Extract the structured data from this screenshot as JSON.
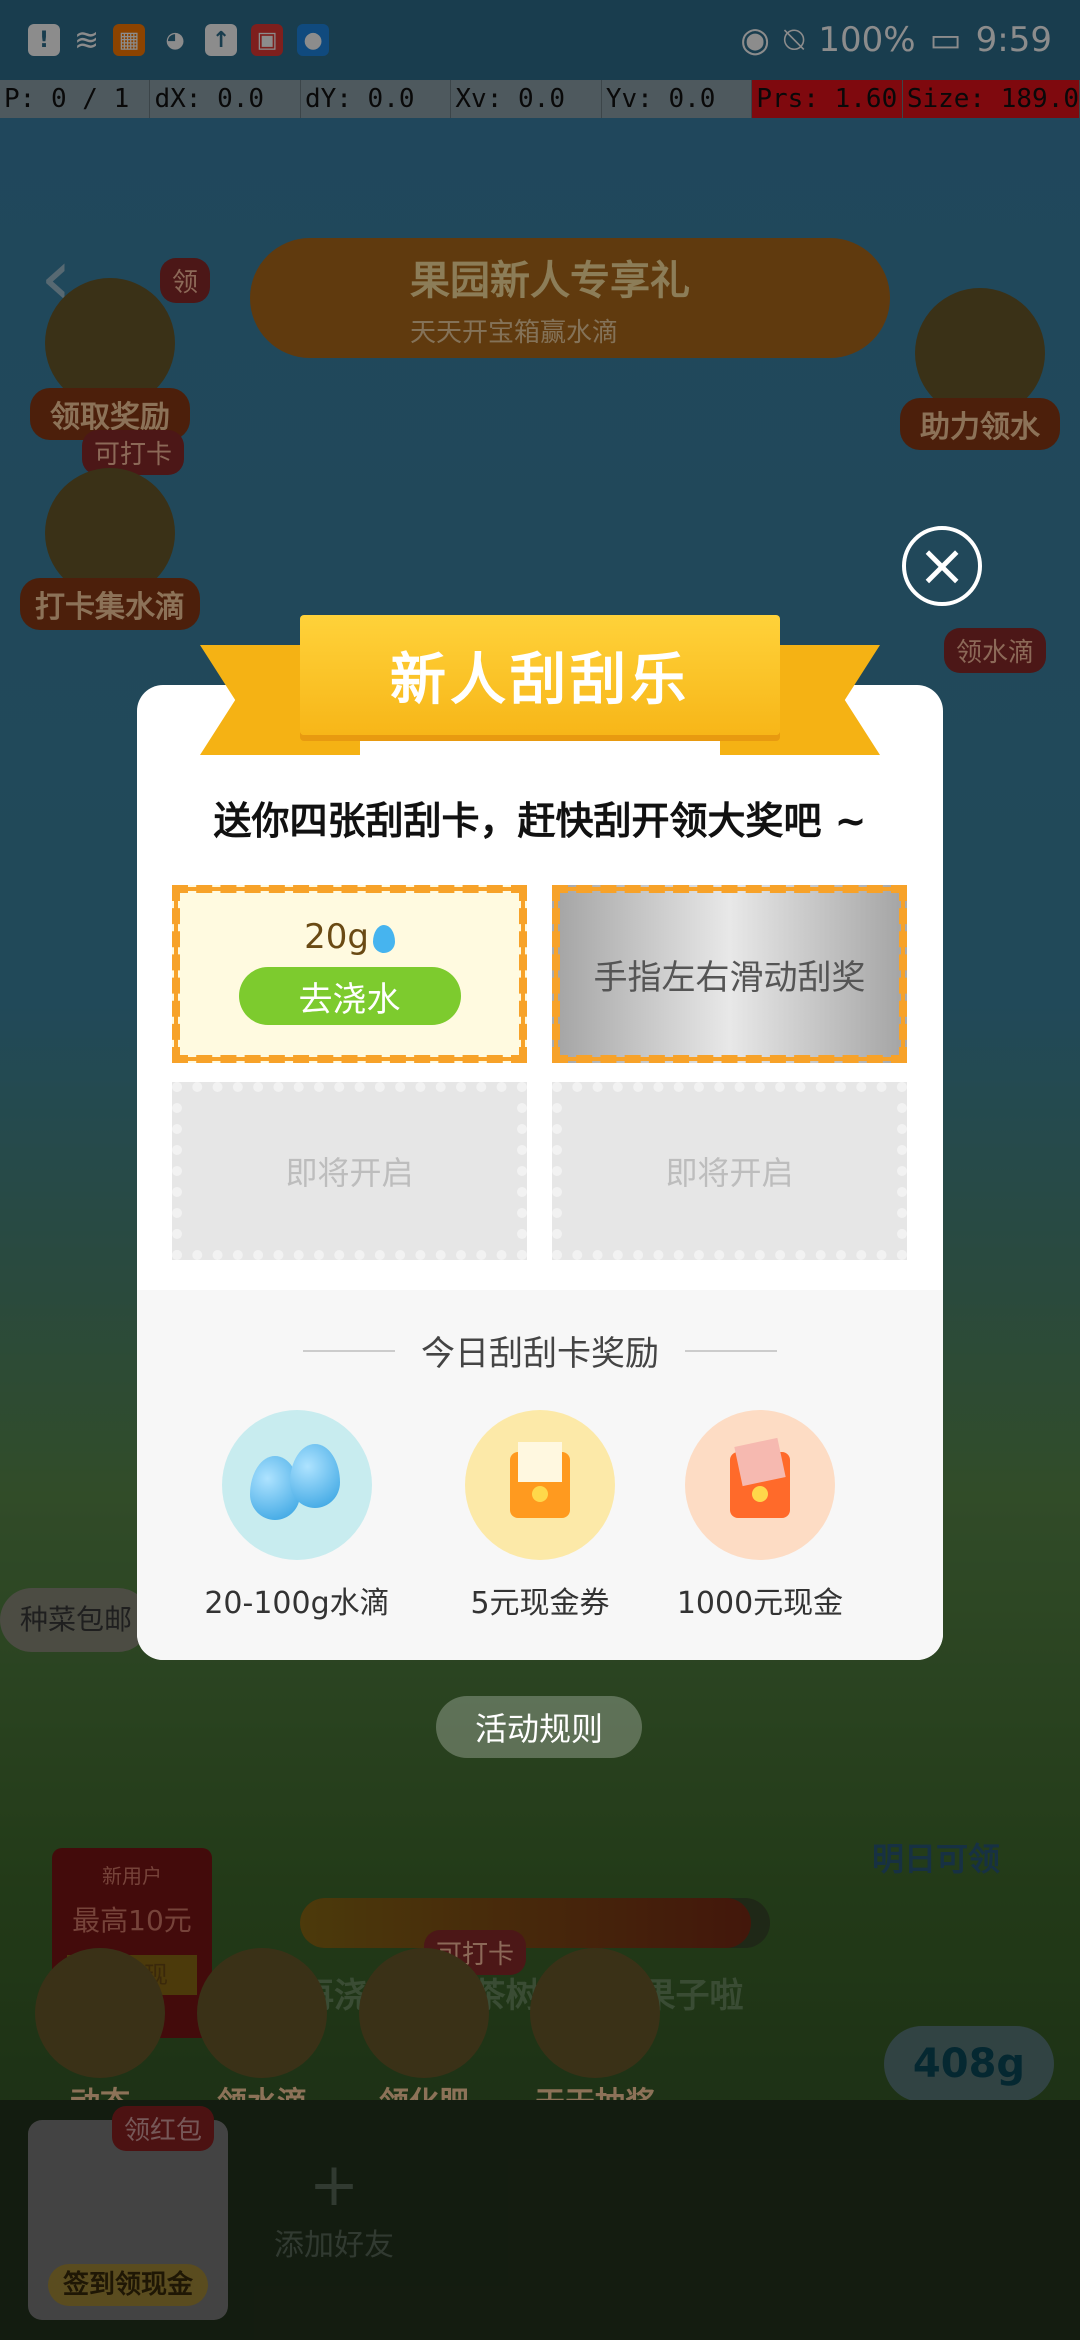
{
  "status_bar": {
    "battery": "100%",
    "time": "9:59"
  },
  "debug_bar": {
    "p": "P: 0 / 1",
    "dx": "dX: 0.0",
    "dy": "dY: 0.0",
    "xv": "Xv: 0.0",
    "yv": "Yv: 0.0",
    "prs": "Prs: 1.60",
    "size": "Size: 189.0"
  },
  "background": {
    "banner_title": "果园新人专享礼",
    "banner_subtitle": "天天开宝箱赢水滴",
    "left_buttons": [
      "领取奖励",
      "打卡集水滴"
    ],
    "left_tag": "可打卡",
    "left_small_tag": "领",
    "right_buttons": [
      "助力领水",
      "领水滴"
    ],
    "right_tag": "领水滴",
    "side_label": "种菜包邮",
    "tomorrow": "明日可领",
    "rules": "活动规则",
    "cash": {
      "tag": "新用户",
      "amount": "最高10元",
      "btn": "可提现"
    },
    "tip": "再浇水2次 茶树就长出果子啦",
    "bottom_icons": [
      "动态",
      "领水滴",
      "领化肥",
      "天天抽奖"
    ],
    "bottom_tag": "可打卡",
    "kettle": "408g",
    "signin_tag": "领红包",
    "signin_label": "签到领现金",
    "add_friend": "添加好友"
  },
  "modal": {
    "ribbon_title": "新人刮刮乐",
    "subtitle": "送你四张刮刮卡，赶快刮开领大奖吧 ~",
    "cards": {
      "c1_amount": "20g",
      "c1_button": "去浇水",
      "c2_text": "手指左右滑动刮奖",
      "c3_text": "即将开启",
      "c4_text": "即将开启"
    },
    "reward_header": "今日刮刮卡奖励",
    "rewards": [
      "20-100g水滴",
      "5元现金券",
      "1000元现金"
    ]
  }
}
